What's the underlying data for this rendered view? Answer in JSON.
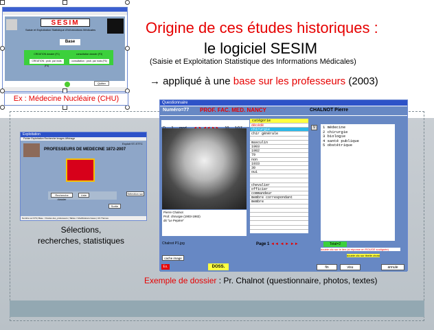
{
  "slide": {
    "title_line1": "Origine de ces études historiques :",
    "title_line2": "le logiciel SESIM",
    "subtitle": "(Saisie et Exploitation Statistique des Informations Médicales)",
    "applied_prefix": "→ appliqué à une ",
    "applied_highlight": "base sur les professeurs",
    "applied_suffix": " (2003)",
    "example_label": "Ex : Médecine Nucléaire (CHU)",
    "caption_left_line1": "Sélections,",
    "caption_left_line2": "recherches, statistiques",
    "caption_right_prefix": "Exemple de dossier",
    "caption_right_suffix": " : Pr. Chalnot (questionnaire, photos, textes)"
  },
  "sesim_app": {
    "logo": "SESIM",
    "subtitle": "Saisie et Exploitation Statistique d'Informations Médicales",
    "base_button": "Base",
    "buttons": [
      "CREATION dossier (F1)",
      "consultation dossier (F3)",
      "CREATION : prob. par mots (F4)",
      "consultation : prob. par mots (F6)"
    ],
    "quit": "Quitter"
  },
  "expl_app": {
    "title": "Exploitation",
    "menu": "Fichier  Exploitation  Recherche  Images  Affichage",
    "heading": "PROFESSEURS DE MEDECINE 1872-2007",
    "topright": "Exploit ST-STTC",
    "btn_recherche": "Recherche dossier",
    "btn_liste": "Liste",
    "btn_selection": "Sélection sur",
    "btn_quit": "Sortie",
    "status": "Nombre sur 679 | Base : //Cartes des_professeurs | Tables = Modifications bases | 0/1 Thèmes"
  },
  "quest_app": {
    "title": "Questionnaire",
    "numero": "Numéro=77",
    "prof": "PROF. FAC. MED. NANCY",
    "name": "CHALNOT Pierre",
    "nav_d": "D",
    "nav_1": "1",
    "nav_mod": "mod.",
    "nav_count": "10",
    "nav_pages": "1/17",
    "category": "catégorie",
    "fields": [
      "décédé",
      "chirurgie",
      "chir générale",
      "",
      "masculin",
      "1903",
      "1982",
      "79",
      "non",
      "1933",
      "30",
      "oui",
      "",
      "",
      "chevalier",
      "officier",
      "commandeur",
      "membre correspondant",
      "membre",
      "",
      "",
      "",
      "",
      "",
      ""
    ],
    "profile_list": [
      "1  médecine",
      "2  chirurgie",
      "3  biologie",
      "4  santé publique",
      "5  obstétrique"
    ],
    "v_button": "V",
    "photo_caption": "Pierre Chalnot\nProf. chirurgie (1903-1982)\ndit \"Le Pepère\"",
    "filename": "Chalnot P1.jpg",
    "cache_image": "cache image",
    "page": "Page 1",
    "total": "Total=2",
    "hint1": "double clic sur le lien (si réponse en ROUGE soulignée)",
    "hint2": "double clic sur libellé choisi",
    "doss": "DOSS.",
    "btn_fin": "fin",
    "btn_visu": "visu",
    "btn_annule": "annule",
    "ex_label": "Ex."
  }
}
